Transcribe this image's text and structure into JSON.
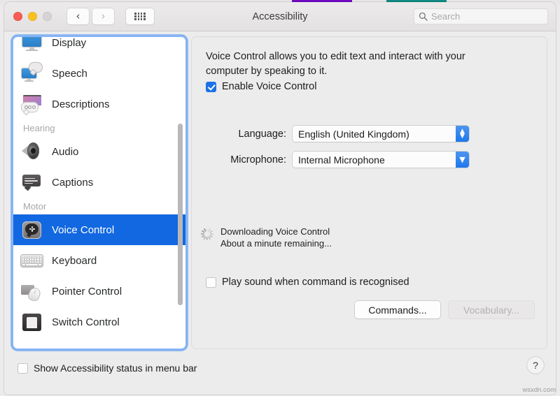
{
  "window": {
    "title": "Accessibility",
    "traffic_lights": [
      "close",
      "minimize",
      "zoom-disabled"
    ],
    "nav_back_icon": "chevron-left",
    "nav_forward_icon": "chevron-right",
    "grid_icon": "show-all-grid"
  },
  "search": {
    "placeholder": "Search",
    "value": "",
    "icon": "search-icon"
  },
  "sidebar": {
    "items": [
      {
        "label": "Display",
        "icon": "display-icon",
        "type": "item",
        "selected": false
      },
      {
        "label": "Speech",
        "icon": "speech-icon",
        "type": "item",
        "selected": false
      },
      {
        "label": "Descriptions",
        "icon": "descriptions-icon",
        "type": "item",
        "selected": false
      },
      {
        "label": "Hearing",
        "icon": "",
        "type": "group",
        "selected": false
      },
      {
        "label": "Audio",
        "icon": "audio-icon",
        "type": "item",
        "selected": false
      },
      {
        "label": "Captions",
        "icon": "captions-icon",
        "type": "item",
        "selected": false
      },
      {
        "label": "Motor",
        "icon": "",
        "type": "group",
        "selected": false
      },
      {
        "label": "Voice Control",
        "icon": "voice-control-icon",
        "type": "item",
        "selected": true
      },
      {
        "label": "Keyboard",
        "icon": "keyboard-icon",
        "type": "item",
        "selected": false
      },
      {
        "label": "Pointer Control",
        "icon": "pointer-control-icon",
        "type": "item",
        "selected": false
      },
      {
        "label": "Switch Control",
        "icon": "switch-control-icon",
        "type": "item",
        "selected": false
      }
    ],
    "selection_color": "#1268e0",
    "focus_ring_color": "#5a9bf0"
  },
  "panel": {
    "description": "Voice Control allows you to edit text and interact with your computer by speaking to it.",
    "enable_checkbox": {
      "label": "Enable Voice Control",
      "checked": true
    },
    "language": {
      "label": "Language:",
      "value": "English (United Kingdom)",
      "arrow_icon": "chevron-up-down-icon"
    },
    "microphone": {
      "label": "Microphone:",
      "value": "Internal Microphone",
      "arrow_icon": "chevron-down-icon"
    },
    "download": {
      "icon": "spinner-icon",
      "title": "Downloading Voice Control",
      "subtitle": "About a minute remaining..."
    },
    "play_sound_checkbox": {
      "label": "Play sound when command is recognised",
      "checked": false
    },
    "buttons": [
      {
        "label": "Commands...",
        "disabled": false
      },
      {
        "label": "Vocabulary...",
        "disabled": true
      }
    ]
  },
  "footer": {
    "status_checkbox": {
      "label": "Show Accessibility status in menu bar",
      "checked": false
    },
    "help_label": "?",
    "help_icon": "help-icon"
  },
  "watermark": "wsxdn.com",
  "background_tabs": [
    {
      "color": "#7209c4"
    },
    {
      "color": "#0f8a82"
    }
  ]
}
